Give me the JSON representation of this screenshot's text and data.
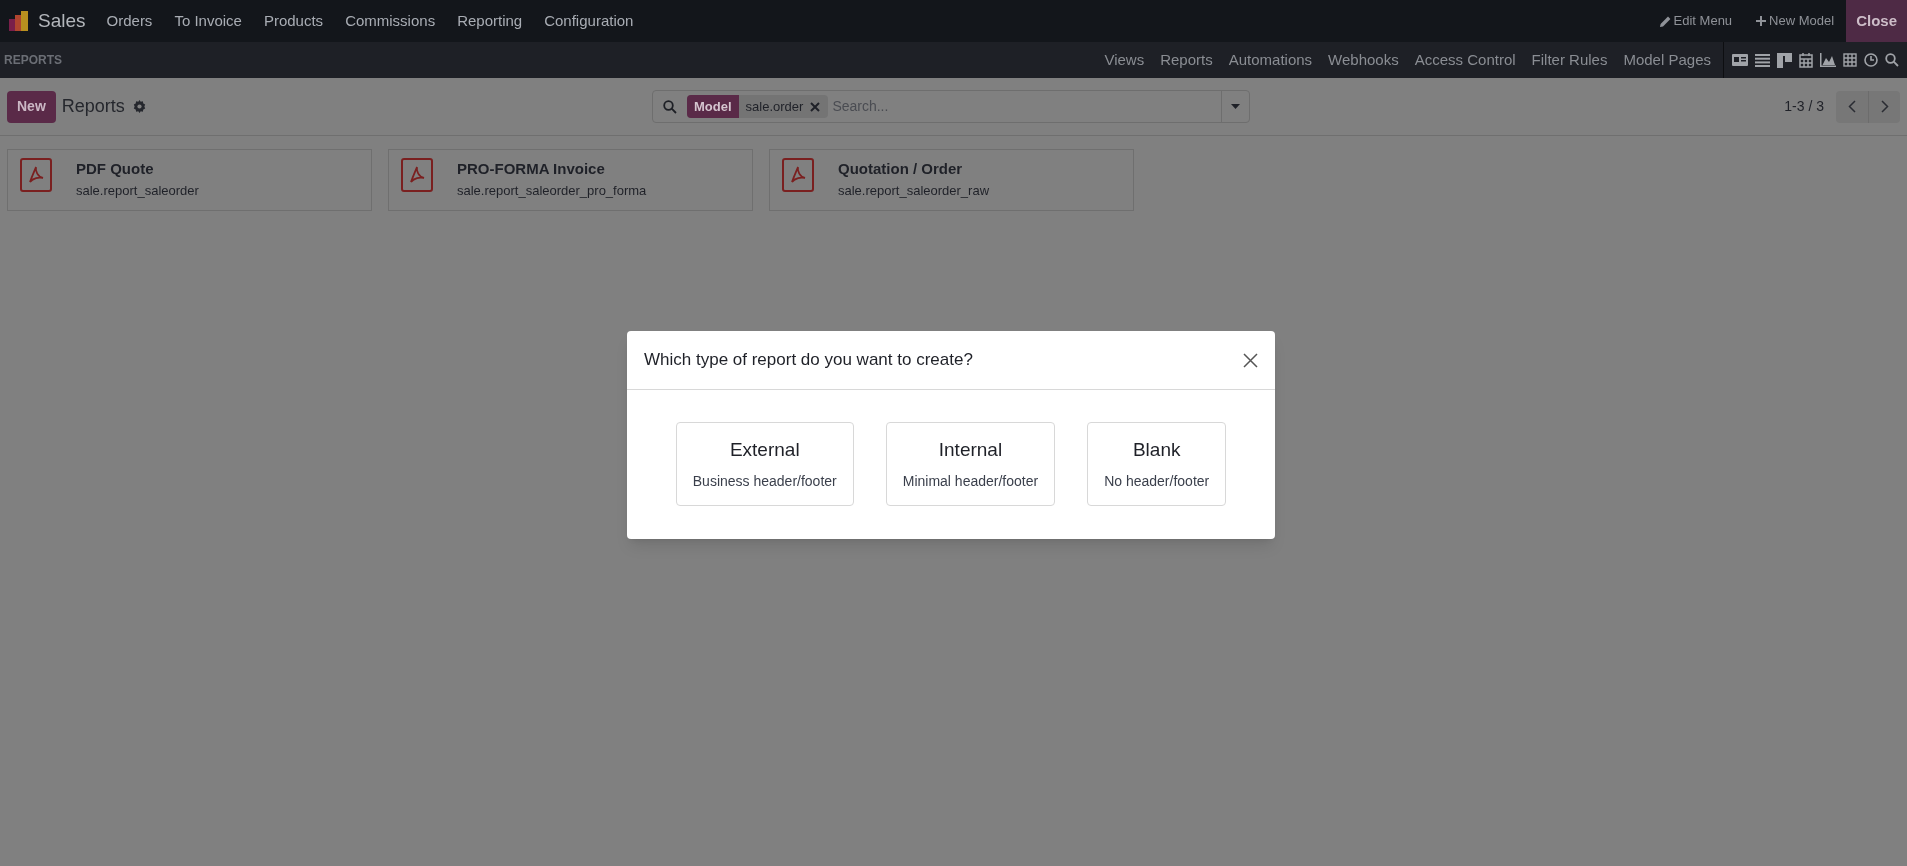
{
  "navbar": {
    "app": "Sales",
    "menu": [
      "Orders",
      "To Invoice",
      "Products",
      "Commissions",
      "Reporting",
      "Configuration"
    ],
    "actions": [
      {
        "label": "Edit Menu",
        "kind": "edit"
      },
      {
        "label": "New Model",
        "kind": "create"
      }
    ],
    "close": "Close"
  },
  "studio_bar": {
    "title": "REPORTS",
    "tabs": [
      "Views",
      "Reports",
      "Automations",
      "Webhooks",
      "Access Control",
      "Filter Rules",
      "Model Pages"
    ]
  },
  "control_panel": {
    "new_button": "New",
    "title": "Reports",
    "search": {
      "facet_label": "Model",
      "facet_value": "sale.order",
      "placeholder": "Search..."
    },
    "pager": "1-3 / 3"
  },
  "cards": [
    {
      "title": "PDF Quote",
      "subtitle": "sale.report_saleorder"
    },
    {
      "title": "PRO-FORMA Invoice",
      "subtitle": "sale.report_saleorder_pro_forma"
    },
    {
      "title": "Quotation / Order",
      "subtitle": "sale.report_saleorder_raw"
    }
  ],
  "dialog": {
    "title": "Which type of report do you want to create?",
    "options": [
      {
        "title": "External",
        "subtitle": "Business header/footer"
      },
      {
        "title": "Internal",
        "subtitle": "Minimal header/footer"
      },
      {
        "title": "Blank",
        "subtitle": "No header/footer"
      }
    ]
  }
}
